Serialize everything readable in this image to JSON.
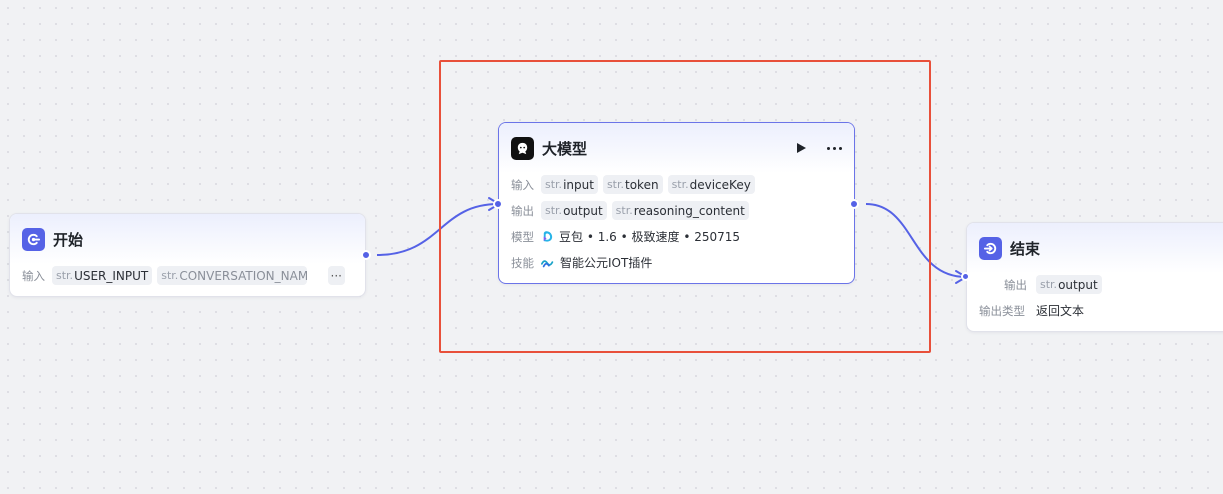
{
  "canvas": {
    "background": "#f1f2f4",
    "edge_color": "#5562e6",
    "selection_color": "#e8503a"
  },
  "start_node": {
    "title": "开始",
    "input_label": "输入",
    "inputs": [
      {
        "type": "str.",
        "name": "USER_INPUT"
      },
      {
        "type": "str.",
        "name": "CONVERSATION_NAME"
      }
    ],
    "more_label": "···"
  },
  "llm_node": {
    "title": "大模型",
    "input_label": "输入",
    "inputs": [
      {
        "type": "str.",
        "name": "input"
      },
      {
        "type": "str.",
        "name": "token"
      },
      {
        "type": "str.",
        "name": "deviceKey"
      }
    ],
    "output_label": "输出",
    "outputs": [
      {
        "type": "str.",
        "name": "output"
      },
      {
        "type": "str.",
        "name": "reasoning_content"
      }
    ],
    "model_label": "模型",
    "model_value": "豆包 • 1.6 • 极致速度 • 250715",
    "skill_label": "技能",
    "skill_value": "智能公元IOT插件",
    "run_icon": "play-icon",
    "more_icon": "more-icon"
  },
  "end_node": {
    "title": "结束",
    "output_label": "输出",
    "output": {
      "type": "str.",
      "name": "output"
    },
    "output_type_label": "输出类型",
    "output_type_value": "返回文本"
  }
}
